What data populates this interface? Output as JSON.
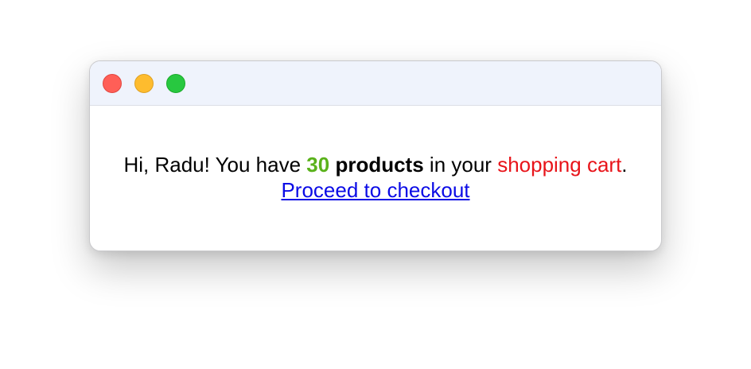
{
  "window": {
    "controls": {
      "close_color": "#ff5f57",
      "minimize_color": "#febc2e",
      "zoom_color": "#28c840"
    }
  },
  "message": {
    "greeting": "Hi, Radu! You have ",
    "count": "30",
    "products_label": "products",
    "middle": " in your ",
    "cart_label": "shopping cart",
    "period": ". ",
    "checkout_link": "Proceed to checkout"
  },
  "colors": {
    "count": "#5ab21b",
    "cart": "#e8141a",
    "link": "#0b0be6"
  }
}
